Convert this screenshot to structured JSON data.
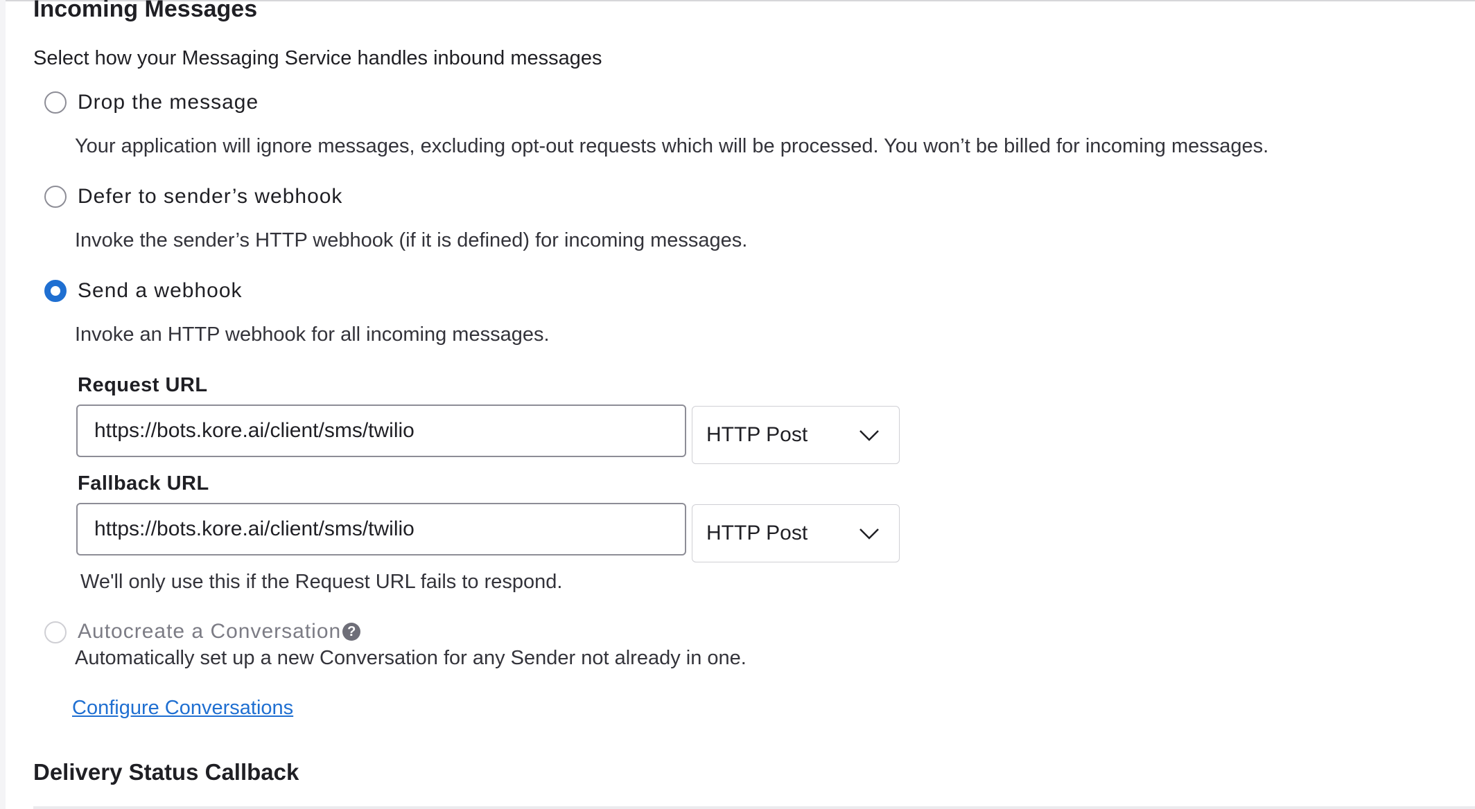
{
  "incoming": {
    "title": "Incoming Messages",
    "intro": "Select how your Messaging Service handles inbound messages",
    "options": [
      {
        "label": "Drop the message",
        "description": "Your application will ignore messages, excluding opt-out requests which will be processed. You won’t be billed for incoming messages.",
        "selected": false
      },
      {
        "label": "Defer to sender’s webhook",
        "description": "Invoke the sender’s HTTP webhook (if it is defined) for incoming messages.",
        "selected": false
      },
      {
        "label": "Send a webhook",
        "description": "Invoke an HTTP webhook for all incoming messages.",
        "selected": true
      }
    ],
    "request_url": {
      "label": "Request URL",
      "value": "https://bots.kore.ai/client/sms/twilio",
      "method": "HTTP Post"
    },
    "fallback_url": {
      "label": "Fallback URL",
      "value": "https://bots.kore.ai/client/sms/twilio",
      "method": "HTTP Post",
      "help": "We'll only use this if the Request URL fails to respond."
    },
    "autocreate": {
      "label": "Autocreate a Conversation",
      "help_icon": "question-circle-icon",
      "description": "Automatically set up a new Conversation for any Sender not already in one.",
      "disabled": true
    },
    "configure_link": "Configure Conversations"
  },
  "delivery": {
    "title": "Delivery Status Callback"
  },
  "colors": {
    "accent": "#1f6fd1",
    "text": "#1f1f24",
    "muted": "#7c7c85",
    "border": "#8d8d96"
  }
}
